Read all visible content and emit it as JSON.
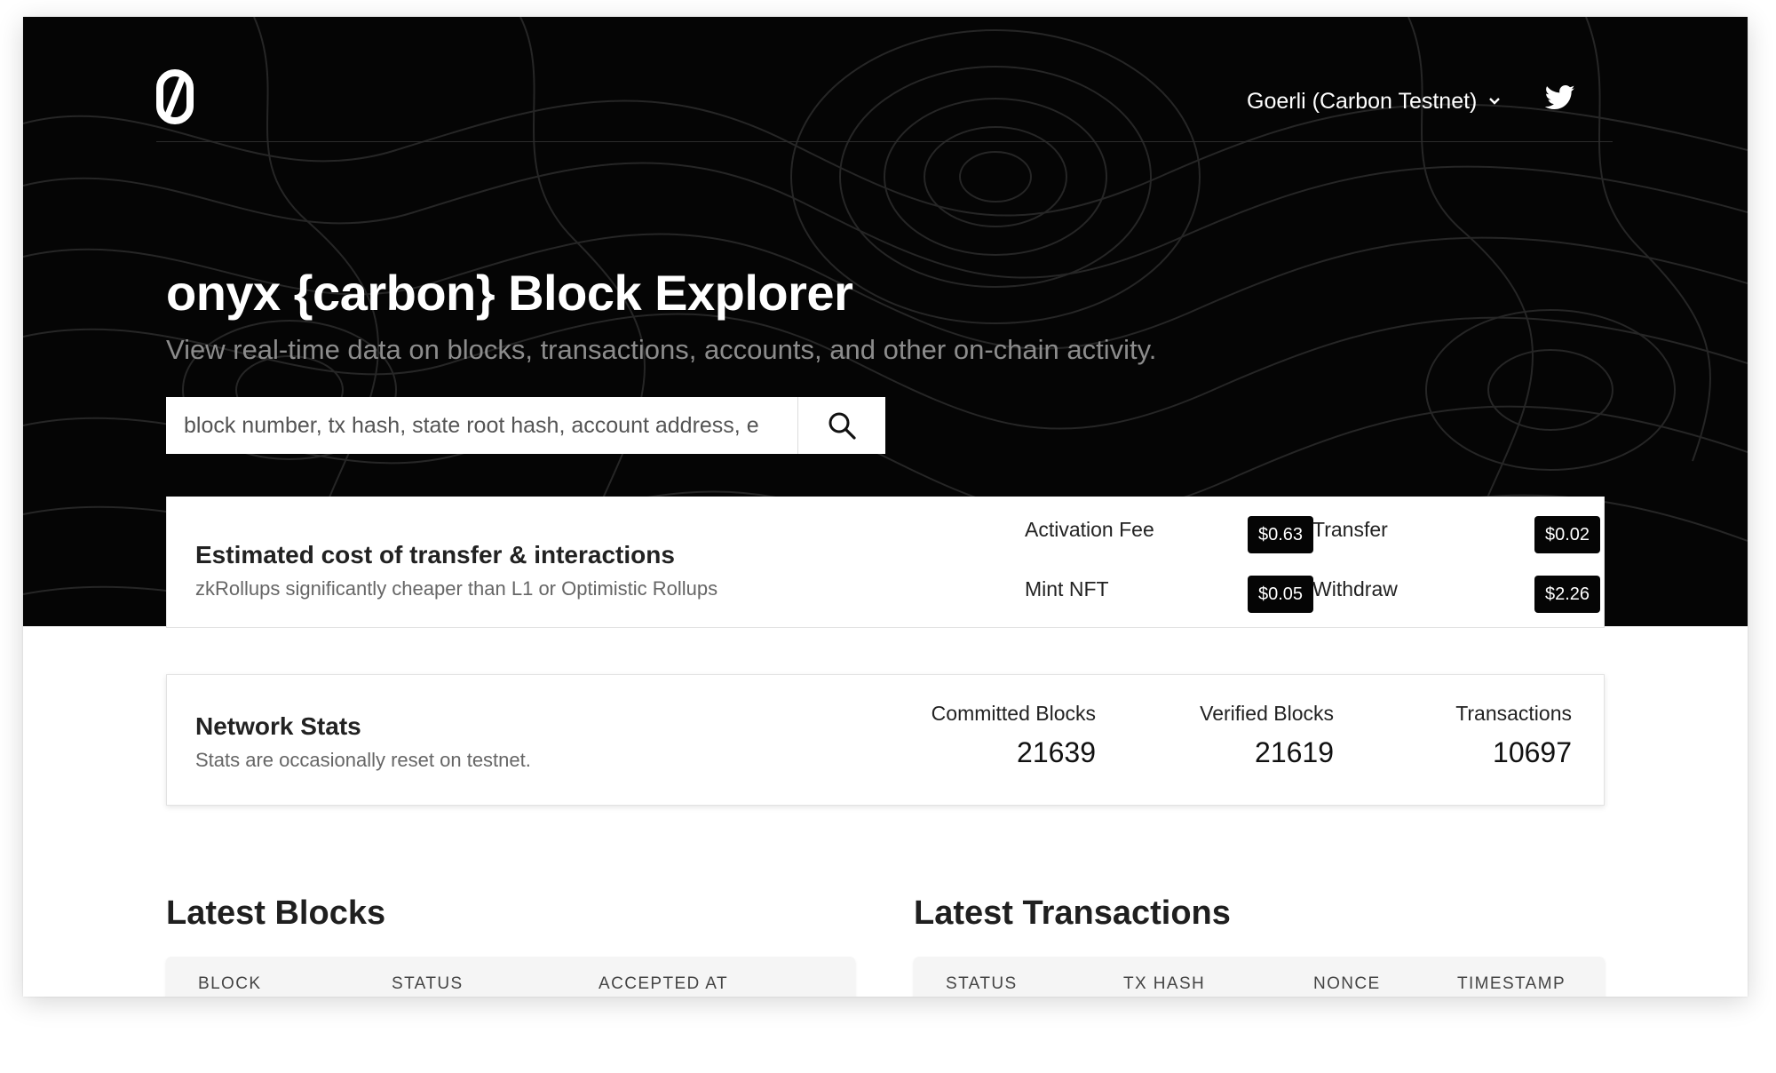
{
  "header": {
    "logo_icon": "onyx-zero-logo-icon",
    "network_selector": "Goerli (Carbon Testnet)",
    "social_icon": "twitter-icon"
  },
  "hero": {
    "title": "onyx {carbon} Block Explorer",
    "subtitle": "View real-time data on blocks, transactions, accounts, and other on-chain activity.",
    "search": {
      "placeholder": "block number, tx hash, state root hash, account address, e",
      "button_icon": "search-icon"
    }
  },
  "cost": {
    "title": "Estimated cost of transfer & interactions",
    "subtitle": "zkRollups significantly cheaper than L1 or Optimistic Rollups",
    "fees": [
      {
        "label": "Activation Fee",
        "value": "$0.63"
      },
      {
        "label": "Transfer",
        "value": "$0.02"
      },
      {
        "label": "Mint NFT",
        "value": "$0.05"
      },
      {
        "label": "Withdraw",
        "value": "$2.26"
      }
    ]
  },
  "network_stats": {
    "title": "Network Stats",
    "subtitle": "Stats are occasionally reset on testnet.",
    "stats": [
      {
        "label": "Committed Blocks",
        "value": "21639"
      },
      {
        "label": "Verified Blocks",
        "value": "21619"
      },
      {
        "label": "Transactions",
        "value": "10697"
      }
    ]
  },
  "latest_blocks": {
    "title": "Latest Blocks",
    "columns": [
      "BLOCK",
      "STATUS",
      "ACCEPTED AT"
    ]
  },
  "latest_transactions": {
    "title": "Latest Transactions",
    "columns": [
      "STATUS",
      "TX HASH",
      "NONCE",
      "TIMESTAMP"
    ]
  },
  "colors": {
    "hero_background": "#050505",
    "badge_background": "#050505",
    "subtitle_gray": "#8c8c8c"
  }
}
